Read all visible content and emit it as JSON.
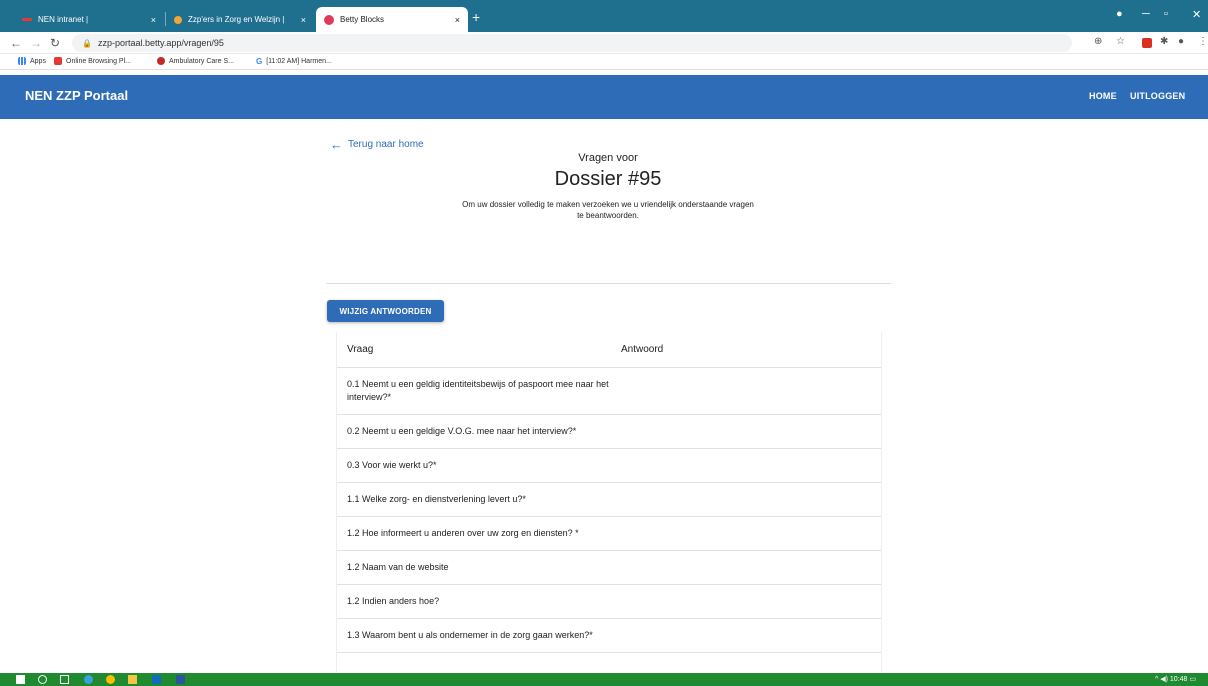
{
  "browser": {
    "tabs": [
      {
        "label": "NEN intranet |",
        "close": "×"
      },
      {
        "label": "Zzp'ers in Zorg en Welzijn |",
        "close": "×"
      },
      {
        "label": "Betty Blocks",
        "close": "×"
      }
    ],
    "new_tab": "+",
    "url": "zzp-portaal.betty.app/vragen/95",
    "bookmarks": [
      "Apps",
      "Online Browsing Pl...",
      "Ambulatory Care S...",
      "[11:02 AM] Harmen..."
    ]
  },
  "app": {
    "brand": "NEN ZZP Portaal",
    "nav": {
      "home": "HOME",
      "logout": "UITLOGGEN"
    }
  },
  "page": {
    "back_label": "Terug naar home",
    "subtitle": "Vragen voor",
    "title": "Dossier #95",
    "intro": "Om uw dossier volledig te maken verzoeken we u vriendelijk onderstaande vragen te beantwoorden.",
    "edit_button": "WIJZIG ANTWOORDEN"
  },
  "table": {
    "headers": {
      "question": "Vraag",
      "answer": "Antwoord"
    },
    "rows": [
      {
        "q": "0.1 Neemt u een geldig identiteitsbewijs of paspoort mee naar het interview?*",
        "a": ""
      },
      {
        "q": "0.2 Neemt u een geldige V.O.G. mee naar het interview?*",
        "a": ""
      },
      {
        "q": "0.3 Voor wie werkt u?*",
        "a": ""
      },
      {
        "q": "1.1 Welke zorg- en dienstverlening levert u?*",
        "a": ""
      },
      {
        "q": "1.2 Hoe informeert u anderen over uw zorg en diensten? *",
        "a": ""
      },
      {
        "q": "1.2 Naam van de website",
        "a": ""
      },
      {
        "q": "1.2 Indien anders hoe?",
        "a": ""
      },
      {
        "q": "1.3 Waarom bent u als ondernemer in de zorg gaan werken?*",
        "a": ""
      }
    ]
  },
  "taskbar": {
    "time": "10:48"
  },
  "colors": {
    "appbar": "#2f6cb7",
    "tabbar": "#1f6f8f",
    "taskbar": "#1f8a2f"
  }
}
